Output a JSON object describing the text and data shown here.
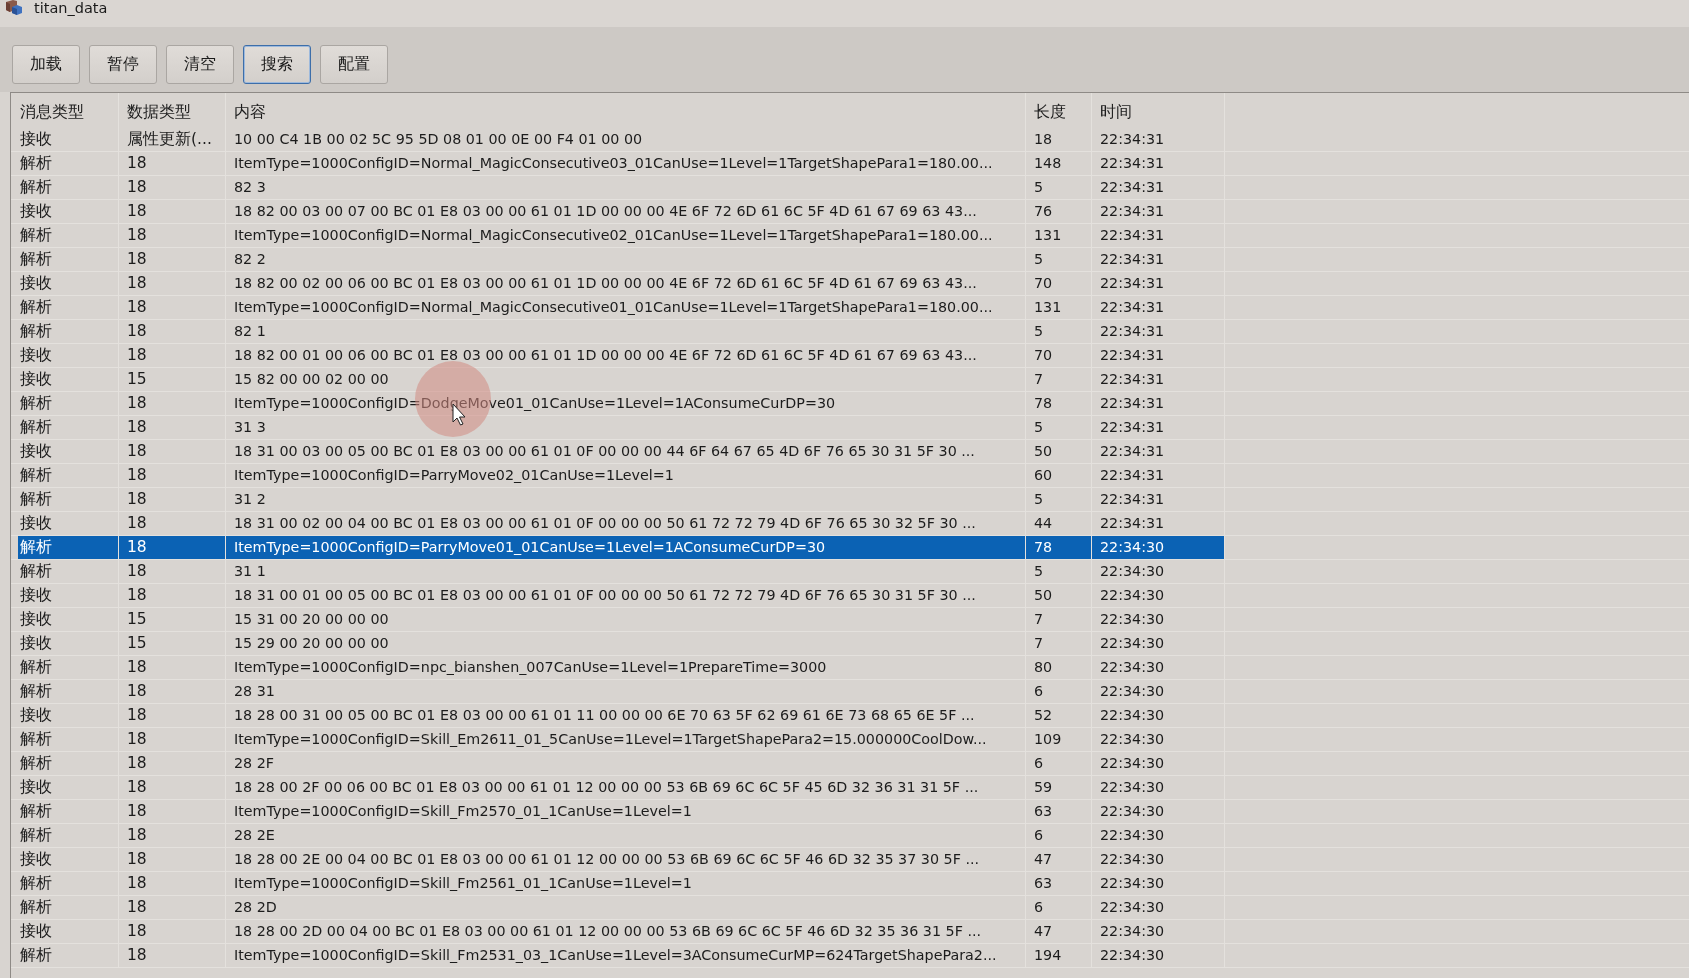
{
  "window": {
    "title": "titan_data"
  },
  "toolbar": [
    {
      "label": "加载",
      "focused": false
    },
    {
      "label": "暂停",
      "focused": false
    },
    {
      "label": "清空",
      "focused": false
    },
    {
      "label": "搜索",
      "focused": true
    },
    {
      "label": "配置",
      "focused": false
    }
  ],
  "table": {
    "columns": [
      "消息类型",
      "数据类型",
      "内容",
      "长度",
      "时间"
    ],
    "rows": [
      {
        "cells": [
          "接收",
          "属性更新(...",
          "10 00 C4 1B 00 02 5C 95 5D 08 01 00 0E 00 F4 01 00 00",
          "18",
          "22:34:31"
        ],
        "selected": false
      },
      {
        "cells": [
          "解析",
          "18",
          "ItemType=1000ConfigID=Normal_MagicConsecutive03_01CanUse=1Level=1TargetShapePara1=180.00...",
          "148",
          "22:34:31"
        ],
        "selected": false
      },
      {
        "cells": [
          "解析",
          "18",
          "82 3",
          "5",
          "22:34:31"
        ],
        "selected": false
      },
      {
        "cells": [
          "接收",
          "18",
          "18 82 00 03 00 07 00 BC 01 E8 03 00 00 61 01 1D 00 00 00 4E 6F 72 6D 61 6C 5F 4D 61 67 69 63 43...",
          "76",
          "22:34:31"
        ],
        "selected": false
      },
      {
        "cells": [
          "解析",
          "18",
          "ItemType=1000ConfigID=Normal_MagicConsecutive02_01CanUse=1Level=1TargetShapePara1=180.00...",
          "131",
          "22:34:31"
        ],
        "selected": false
      },
      {
        "cells": [
          "解析",
          "18",
          "82 2",
          "5",
          "22:34:31"
        ],
        "selected": false
      },
      {
        "cells": [
          "接收",
          "18",
          "18 82 00 02 00 06 00 BC 01 E8 03 00 00 61 01 1D 00 00 00 4E 6F 72 6D 61 6C 5F 4D 61 67 69 63 43...",
          "70",
          "22:34:31"
        ],
        "selected": false
      },
      {
        "cells": [
          "解析",
          "18",
          "ItemType=1000ConfigID=Normal_MagicConsecutive01_01CanUse=1Level=1TargetShapePara1=180.00...",
          "131",
          "22:34:31"
        ],
        "selected": false
      },
      {
        "cells": [
          "解析",
          "18",
          "82 1",
          "5",
          "22:34:31"
        ],
        "selected": false
      },
      {
        "cells": [
          "接收",
          "18",
          "18 82 00 01 00 06 00 BC 01 E8 03 00 00 61 01 1D 00 00 00 4E 6F 72 6D 61 6C 5F 4D 61 67 69 63 43...",
          "70",
          "22:34:31"
        ],
        "selected": false
      },
      {
        "cells": [
          "接收",
          "15",
          "15 82 00 00 02 00 00",
          "7",
          "22:34:31"
        ],
        "selected": false
      },
      {
        "cells": [
          "解析",
          "18",
          "ItemType=1000ConfigID=DodgeMove01_01CanUse=1Level=1AConsumeCurDP=30",
          "78",
          "22:34:31"
        ],
        "selected": false
      },
      {
        "cells": [
          "解析",
          "18",
          "31 3",
          "5",
          "22:34:31"
        ],
        "selected": false
      },
      {
        "cells": [
          "接收",
          "18",
          "18 31 00 03 00 05 00 BC 01 E8 03 00 00 61 01 0F 00 00 00 44 6F 64 67 65 4D 6F 76 65 30 31 5F 30 ...",
          "50",
          "22:34:31"
        ],
        "selected": false
      },
      {
        "cells": [
          "解析",
          "18",
          "ItemType=1000ConfigID=ParryMove02_01CanUse=1Level=1",
          "60",
          "22:34:31"
        ],
        "selected": false
      },
      {
        "cells": [
          "解析",
          "18",
          "31 2",
          "5",
          "22:34:31"
        ],
        "selected": false
      },
      {
        "cells": [
          "接收",
          "18",
          "18 31 00 02 00 04 00 BC 01 E8 03 00 00 61 01 0F 00 00 00 50 61 72 72 79 4D 6F 76 65 30 32 5F 30 ...",
          "44",
          "22:34:31"
        ],
        "selected": false
      },
      {
        "cells": [
          "解析",
          "18",
          "ItemType=1000ConfigID=ParryMove01_01CanUse=1Level=1AConsumeCurDP=30",
          "78",
          "22:34:30"
        ],
        "selected": true
      },
      {
        "cells": [
          "解析",
          "18",
          "31 1",
          "5",
          "22:34:30"
        ],
        "selected": false
      },
      {
        "cells": [
          "接收",
          "18",
          "18 31 00 01 00 05 00 BC 01 E8 03 00 00 61 01 0F 00 00 00 50 61 72 72 79 4D 6F 76 65 30 31 5F 30 ...",
          "50",
          "22:34:30"
        ],
        "selected": false
      },
      {
        "cells": [
          "接收",
          "15",
          "15 31 00 20 00 00 00",
          "7",
          "22:34:30"
        ],
        "selected": false
      },
      {
        "cells": [
          "接收",
          "15",
          "15 29 00 20 00 00 00",
          "7",
          "22:34:30"
        ],
        "selected": false
      },
      {
        "cells": [
          "解析",
          "18",
          "ItemType=1000ConfigID=npc_bianshen_007CanUse=1Level=1PrepareTime=3000",
          "80",
          "22:34:30"
        ],
        "selected": false
      },
      {
        "cells": [
          "解析",
          "18",
          "28 31",
          "6",
          "22:34:30"
        ],
        "selected": false
      },
      {
        "cells": [
          "接收",
          "18",
          "18 28 00 31 00 05 00 BC 01 E8 03 00 00 61 01 11 00 00 00 6E 70 63 5F 62 69 61 6E 73 68 65 6E 5F ...",
          "52",
          "22:34:30"
        ],
        "selected": false
      },
      {
        "cells": [
          "解析",
          "18",
          "ItemType=1000ConfigID=Skill_Em2611_01_5CanUse=1Level=1TargetShapePara2=15.000000CoolDow...",
          "109",
          "22:34:30"
        ],
        "selected": false
      },
      {
        "cells": [
          "解析",
          "18",
          "28 2F",
          "6",
          "22:34:30"
        ],
        "selected": false
      },
      {
        "cells": [
          "接收",
          "18",
          "18 28 00 2F 00 06 00 BC 01 E8 03 00 00 61 01 12 00 00 00 53 6B 69 6C 6C 5F 45 6D 32 36 31 31 5F ...",
          "59",
          "22:34:30"
        ],
        "selected": false
      },
      {
        "cells": [
          "解析",
          "18",
          "ItemType=1000ConfigID=Skill_Fm2570_01_1CanUse=1Level=1",
          "63",
          "22:34:30"
        ],
        "selected": false
      },
      {
        "cells": [
          "解析",
          "18",
          "28 2E",
          "6",
          "22:34:30"
        ],
        "selected": false
      },
      {
        "cells": [
          "接收",
          "18",
          "18 28 00 2E 00 04 00 BC 01 E8 03 00 00 61 01 12 00 00 00 53 6B 69 6C 6C 5F 46 6D 32 35 37 30 5F ...",
          "47",
          "22:34:30"
        ],
        "selected": false
      },
      {
        "cells": [
          "解析",
          "18",
          "ItemType=1000ConfigID=Skill_Fm2561_01_1CanUse=1Level=1",
          "63",
          "22:34:30"
        ],
        "selected": false
      },
      {
        "cells": [
          "解析",
          "18",
          "28 2D",
          "6",
          "22:34:30"
        ],
        "selected": false
      },
      {
        "cells": [
          "接收",
          "18",
          "18 28 00 2D 00 04 00 BC 01 E8 03 00 00 61 01 12 00 00 00 53 6B 69 6C 6C 5F 46 6D 32 35 36 31 5F ...",
          "47",
          "22:34:30"
        ],
        "selected": false
      },
      {
        "cells": [
          "解析",
          "18",
          "ItemType=1000ConfigID=Skill_Fm2531_03_1CanUse=1Level=3AConsumeCurMP=624TargetShapePara2...",
          "194",
          "22:34:30"
        ],
        "selected": false
      }
    ]
  }
}
